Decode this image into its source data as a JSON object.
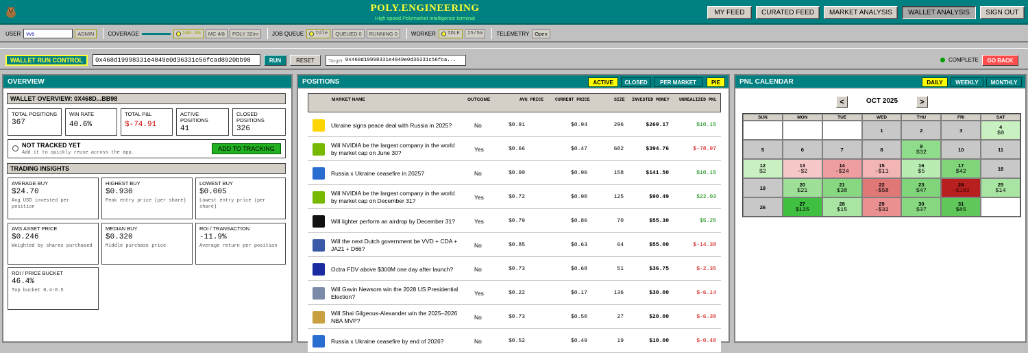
{
  "header": {
    "title": "POLY.ENGINEERING",
    "subtitle": "High speed Polymarket intelligence terminal",
    "nav": [
      "MY FEED",
      "CURATED FEED",
      "MARKET ANALYSIS",
      "WALLET ANALYSIS",
      "SIGN OUT"
    ],
    "active_nav": "WALLET ANALYSIS"
  },
  "status": {
    "user_label": "USER",
    "user_value": "vvs",
    "admin_badge": "ADMIN",
    "coverage_label": "COVERAGE",
    "coverage_pct": "100.0%",
    "mc": "MC 4/8",
    "poly": "POLY 32/m",
    "job_label": "JOB QUEUE",
    "job_state": "Idle",
    "queued": "QUEUED 0",
    "running": "RUNNING 0",
    "worker_label": "WORKER",
    "worker_state": "IDLE",
    "worker_rate": "25/5m",
    "telemetry_label": "TELEMETRY",
    "telemetry_value": "Open"
  },
  "control": {
    "title": "WALLET RUN CONTROL",
    "wallet": "0x468d19998331e4849e0d36331c56fcad8920bb98",
    "run": "RUN",
    "reset": "RESET",
    "target_label": "Target",
    "target_value": "0x468d19998331e4849e0d36331c56fca...",
    "complete": "COMPLETE",
    "go_back": "GO BACK"
  },
  "overview": {
    "title": "OVERVIEW",
    "wallet_header": "WALLET OVERVIEW: 0X468D...BB98",
    "stats": [
      {
        "label": "TOTAL POSITIONS",
        "value": "367"
      },
      {
        "label": "WIN RATE",
        "value": "40.6%"
      },
      {
        "label": "TOTAL P&L",
        "value": "$-74.91"
      },
      {
        "label": "ACTIVE POSITIONS",
        "value": "41"
      },
      {
        "label": "CLOSED POSITIONS",
        "value": "326"
      }
    ],
    "tracking_title": "NOT TRACKED YET",
    "tracking_note": "Add it to quickly reuse across the app.",
    "tracking_button": "ADD TO TRACKING",
    "insights_header": "TRADING INSIGHTS",
    "insights": [
      {
        "label": "AVERAGE BUY",
        "value": "$24.70",
        "note": "Avg USD invested per position"
      },
      {
        "label": "HIGHEST BUY",
        "value": "$0.930",
        "note": "Peak entry price (per share)"
      },
      {
        "label": "LOWEST BUY",
        "value": "$0.005",
        "note": "Lowest entry price (per share)"
      },
      {
        "label": "AVG ASSET PRICE",
        "value": "$0.246",
        "note": "Weighted by shares purchased"
      },
      {
        "label": "MEDIAN BUY",
        "value": "$0.320",
        "note": "Middle purchase price"
      },
      {
        "label": "ROI / TRANSACTION",
        "value": "-11.9%",
        "note": "Average return per position"
      },
      {
        "label": "ROI / PRICE BUCKET",
        "value": "46.4%",
        "note": "Top bucket 0.4-0.5"
      }
    ]
  },
  "positions": {
    "title": "POSITIONS",
    "tabs": [
      "ACTIVE",
      "CLOSED",
      "PER MARKET",
      "PIE"
    ],
    "columns": [
      "MARKET NAME",
      "OUTCOME",
      "AVG PRICE",
      "CURRENT PRICE",
      "SIZE",
      "INVESTED MONEY",
      "UNREALIZED PNL"
    ],
    "rows": [
      {
        "market": "Ukraine signs peace deal with Russia in 2025?",
        "outcome": "No",
        "avg": "$0.91",
        "cur": "$0.94",
        "size": "296",
        "invested": "$269.17",
        "pnl": "$10.15",
        "icon_color": "#ffd500"
      },
      {
        "market": "Will NVIDIA be the largest company in the world by market cap on June 30?",
        "outcome": "Yes",
        "avg": "$0.66",
        "cur": "$0.47",
        "size": "602",
        "invested": "$394.76",
        "pnl": "$-78.97",
        "icon_color": "#76b900"
      },
      {
        "market": "Russia x Ukraine ceasefire in 2025?",
        "outcome": "No",
        "avg": "$0.90",
        "cur": "$0.96",
        "size": "158",
        "invested": "$141.50",
        "pnl": "$10.15",
        "icon_color": "#2a6dd0"
      },
      {
        "market": "Will NVIDIA be the largest company in the world by market cap on December 31?",
        "outcome": "Yes",
        "avg": "$0.72",
        "cur": "$0.90",
        "size": "125",
        "invested": "$90.49",
        "pnl": "$22.03",
        "icon_color": "#76b900"
      },
      {
        "market": "Will lighter perform an airdrop by December 31?",
        "outcome": "Yes",
        "avg": "$0.79",
        "cur": "$0.86",
        "size": "70",
        "invested": "$55.30",
        "pnl": "$5.25",
        "icon_color": "#111111"
      },
      {
        "market": "Will the next Dutch government be VVD + CDA + JA21 + D66?",
        "outcome": "No",
        "avg": "$0.85",
        "cur": "$0.63",
        "size": "64",
        "invested": "$55.00",
        "pnl": "$-14.38",
        "icon_color": "#3a5aa8"
      },
      {
        "market": "Octra FDV above $300M one day after launch?",
        "outcome": "No",
        "avg": "$0.73",
        "cur": "$0.68",
        "size": "51",
        "invested": "$36.75",
        "pnl": "$-2.35",
        "icon_color": "#1a2aa0"
      },
      {
        "market": "Will Gavin Newsom win the 2028 US Presidential Election?",
        "outcome": "Yes",
        "avg": "$0.22",
        "cur": "$0.17",
        "size": "136",
        "invested": "$30.00",
        "pnl": "$-6.14",
        "icon_color": "#7a8aa8"
      },
      {
        "market": "Will Shai Gilgeous-Alexander win the 2025–2026 NBA MVP?",
        "outcome": "No",
        "avg": "$0.73",
        "cur": "$0.50",
        "size": "27",
        "invested": "$20.00",
        "pnl": "$-6.30",
        "icon_color": "#c8a040"
      },
      {
        "market": "Russia x Ukraine ceasefire by end of 2026?",
        "outcome": "No",
        "avg": "$0.52",
        "cur": "$0.49",
        "size": "19",
        "invested": "$10.00",
        "pnl": "$-0.48",
        "icon_color": "#2a6dd0"
      }
    ]
  },
  "pnl_calendar": {
    "title": "PNL CALENDAR",
    "tabs": [
      "DAILY",
      "WEEKLY",
      "MONTHLY"
    ],
    "month": "OCT 2025",
    "prev": "<",
    "next": ">",
    "days": [
      "SUN",
      "MON",
      "TUE",
      "WED",
      "THU",
      "FRI",
      "SAT"
    ],
    "cells": [
      {
        "d": "",
        "p": "",
        "bg": "#ffffff"
      },
      {
        "d": "",
        "p": "",
        "bg": "#ffffff"
      },
      {
        "d": "",
        "p": "",
        "bg": "#ffffff"
      },
      {
        "d": "1",
        "p": "",
        "bg": "#c8c8c8"
      },
      {
        "d": "2",
        "p": "",
        "bg": "#c8c8c8"
      },
      {
        "d": "3",
        "p": "",
        "bg": "#c8c8c8"
      },
      {
        "d": "4",
        "p": "$0",
        "bg": "#c8f0c0"
      },
      {
        "d": "5",
        "p": "",
        "bg": "#c8c8c8"
      },
      {
        "d": "6",
        "p": "",
        "bg": "#c8c8c8"
      },
      {
        "d": "7",
        "p": "",
        "bg": "#c8c8c8"
      },
      {
        "d": "8",
        "p": "",
        "bg": "#c8c8c8"
      },
      {
        "d": "9",
        "p": "$32",
        "bg": "#8fdc8a"
      },
      {
        "d": "10",
        "p": "",
        "bg": "#c8c8c8"
      },
      {
        "d": "11",
        "p": "",
        "bg": "#c8c8c8"
      },
      {
        "d": "12",
        "p": "$2",
        "bg": "#c8f0c0"
      },
      {
        "d": "13",
        "p": "-$2",
        "bg": "#f6c8c8"
      },
      {
        "d": "14",
        "p": "-$24",
        "bg": "#ee9e9e"
      },
      {
        "d": "15",
        "p": "-$11",
        "bg": "#f2b4b4"
      },
      {
        "d": "16",
        "p": "$5",
        "bg": "#b8ecb2"
      },
      {
        "d": "17",
        "p": "$42",
        "bg": "#80d47a"
      },
      {
        "d": "18",
        "p": "",
        "bg": "#c8c8c8"
      },
      {
        "d": "19",
        "p": "",
        "bg": "#c8c8c8"
      },
      {
        "d": "20",
        "p": "$21",
        "bg": "#9ee098"
      },
      {
        "d": "21",
        "p": "$38",
        "bg": "#88d882"
      },
      {
        "d": "22",
        "p": "-$58",
        "bg": "#e07878"
      },
      {
        "d": "23",
        "p": "$47",
        "bg": "#80d47a"
      },
      {
        "d": "24",
        "p": "-$182",
        "bg": "#b82020"
      },
      {
        "d": "25",
        "p": "$14",
        "bg": "#a8e4a2"
      },
      {
        "d": "26",
        "p": "",
        "bg": "#c8c8c8"
      },
      {
        "d": "27",
        "p": "$125",
        "bg": "#40c040"
      },
      {
        "d": "28",
        "p": "$15",
        "bg": "#a8e4a2"
      },
      {
        "d": "29",
        "p": "-$32",
        "bg": "#ea9090"
      },
      {
        "d": "30",
        "p": "$37",
        "bg": "#88d882"
      },
      {
        "d": "31",
        "p": "$85",
        "bg": "#60c85a"
      },
      {
        "d": "",
        "p": "",
        "bg": "#ffffff"
      }
    ]
  }
}
